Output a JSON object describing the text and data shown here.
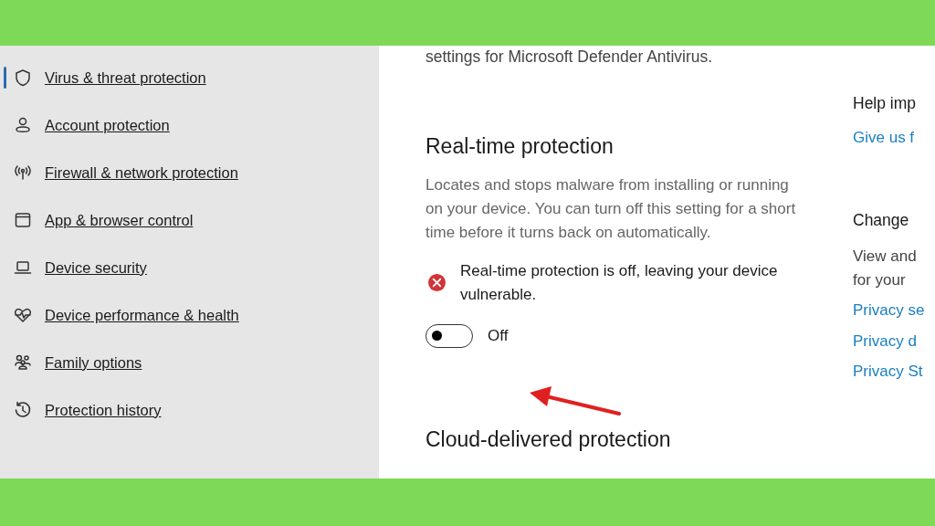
{
  "sidebar": {
    "items": [
      {
        "label": "Virus & threat protection",
        "selected": true
      },
      {
        "label": "Account protection",
        "selected": false
      },
      {
        "label": "Firewall & network protection",
        "selected": false
      },
      {
        "label": "App & browser control",
        "selected": false
      },
      {
        "label": "Device security",
        "selected": false
      },
      {
        "label": "Device performance & health",
        "selected": false
      },
      {
        "label": "Family options",
        "selected": false
      },
      {
        "label": "Protection history",
        "selected": false
      }
    ]
  },
  "main": {
    "intro": "settings for Microsoft Defender Antivirus.",
    "sections": [
      {
        "heading": "Real-time protection",
        "description": "Locates and stops malware from installing or running on your device. You can turn off this setting for a short time before it turns back on automatically.",
        "warning": "Real-time protection is off, leaving your device vulnerable.",
        "toggle": {
          "on": false,
          "label": "Off"
        }
      },
      {
        "heading": "Cloud-delivered protection"
      }
    ]
  },
  "side_panel": {
    "groups": [
      {
        "heading": "Help imp",
        "links": [
          "Give us f"
        ]
      },
      {
        "heading": "Change",
        "body": [
          "View and",
          "for your"
        ],
        "links": [
          "Privacy se",
          "Privacy d",
          "Privacy St"
        ]
      }
    ]
  }
}
